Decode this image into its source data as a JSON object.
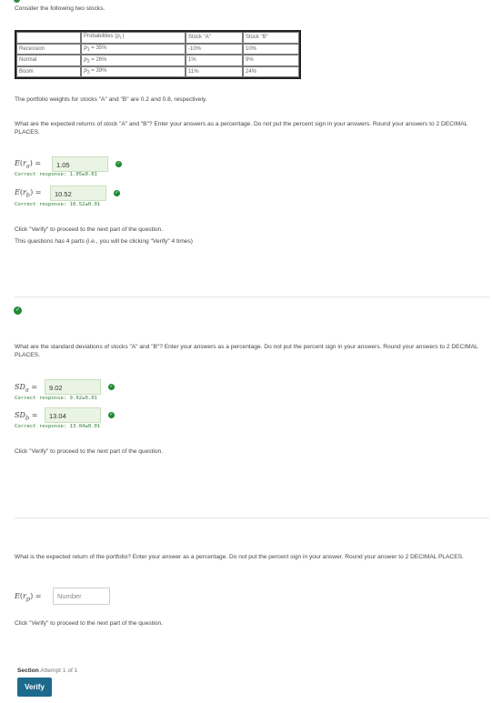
{
  "intro": "Consider the following two stocks.",
  "table": {
    "headers": {
      "state": "",
      "prob": "Probabilities (p",
      "prob_sub": "i",
      "prob_end": ")",
      "a": "Stock \"A\"",
      "b": "Stock \"B\""
    },
    "rows": [
      {
        "state": "Recession",
        "p_var": "p",
        "p_sub": "1",
        "p_val": "= 35%",
        "a": "-10%",
        "b": "10%"
      },
      {
        "state": "Normal",
        "p_var": "p",
        "p_sub": "2",
        "p_val": "= 26%",
        "a": "1%",
        "b": "9%"
      },
      {
        "state": "Boom",
        "p_var": "p",
        "p_sub": "3",
        "p_val": "= 39%",
        "a": "11%",
        "b": "24%"
      }
    ]
  },
  "weights_text": "The portfolio weights for stocks \"A\" and \"B\" are 0.2 and 0.8, respectively.",
  "part1": {
    "question": "What are the expected returns of stock \"A\" and \"B\"? Enter your answers as a percentage. Do not put the percent sign in your answers. Round your answers to 2 DECIMAL PLACES.",
    "answers": [
      {
        "label_fn": "E",
        "label_var": "r",
        "label_sub": "a",
        "value": "1.05",
        "correct": "Correct response: 1.05±0.01"
      },
      {
        "label_fn": "E",
        "label_var": "r",
        "label_sub": "b",
        "value": "10.52",
        "correct": "Correct response: 10.52±0.01"
      }
    ],
    "hint1": "Click \"Verify\" to proceed to the next part of the question.",
    "hint2": "This questions has 4 parts (i.e., you will be clicking \"Verify\" 4 times)"
  },
  "part2": {
    "question": "What are the standard deviations of stocks \"A\" and \"B\"? Enter your answers as a percentage. Do not put the percent sign in your answers. Round your answers to 2 DECIMAL PLACES.",
    "answers": [
      {
        "label_fn": "SD",
        "label_sub": "a",
        "value": "9.02",
        "correct": "Correct response: 9.02±0.01"
      },
      {
        "label_fn": "SD",
        "label_sub": "b",
        "value": "13.04",
        "correct": "Correct response: 13.04±0.01"
      }
    ],
    "hint": "Click \"Verify\" to proceed to the next part of the question."
  },
  "part3": {
    "question": "What is the expected return of the portfolio? Enter your answer as a percentage. Do not put the percent sign in your answer. Round your answer to 2 DECIMAL PLACES.",
    "label_fn": "E",
    "label_var": "r",
    "label_sub": "p",
    "placeholder": "Number",
    "hint": "Click \"Verify\" to proceed to the next part of the question."
  },
  "footer": {
    "section": "Section",
    "attempt": "Attempt 1 of 1",
    "verify": "Verify"
  }
}
